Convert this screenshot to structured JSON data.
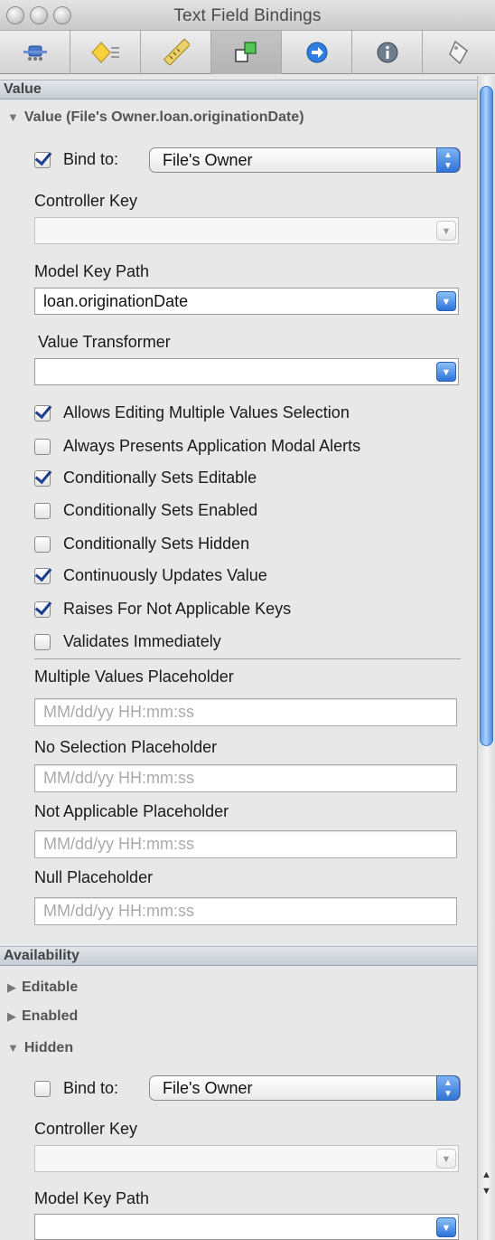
{
  "window": {
    "title": "Text Field Bindings"
  },
  "toolbar": {
    "tabs": [
      {
        "icon": "attributes-icon"
      },
      {
        "icon": "effects-icon"
      },
      {
        "icon": "size-icon"
      },
      {
        "icon": "bindings-icon",
        "active": true
      },
      {
        "icon": "connections-icon"
      },
      {
        "icon": "info-icon"
      },
      {
        "icon": "identity-icon"
      }
    ]
  },
  "value_section": {
    "header": "Value",
    "disclosure": "Value (File's Owner.loan.originationDate)",
    "bind_label": "Bind to:",
    "bind_checked": true,
    "bind_target": "File's Owner",
    "controller_key_label": "Controller Key",
    "controller_key_value": "",
    "model_key_path_label": "Model Key Path",
    "model_key_path_value": "loan.originationDate",
    "value_transformer_label": "Value Transformer",
    "value_transformer_value": "",
    "options": [
      {
        "label": "Allows Editing Multiple Values Selection",
        "checked": true
      },
      {
        "label": "Always Presents Application Modal Alerts",
        "checked": false
      },
      {
        "label": "Conditionally Sets Editable",
        "checked": true
      },
      {
        "label": "Conditionally Sets Enabled",
        "checked": false
      },
      {
        "label": "Conditionally Sets Hidden",
        "checked": false
      },
      {
        "label": "Continuously Updates Value",
        "checked": true
      },
      {
        "label": "Raises For Not Applicable Keys",
        "checked": true
      },
      {
        "label": "Validates Immediately",
        "checked": false
      }
    ],
    "placeholders": [
      {
        "label": "Multiple Values Placeholder",
        "placeholder": "MM/dd/yy HH:mm:ss"
      },
      {
        "label": "No Selection Placeholder",
        "placeholder": "MM/dd/yy HH:mm:ss"
      },
      {
        "label": "Not Applicable Placeholder",
        "placeholder": "MM/dd/yy HH:mm:ss"
      },
      {
        "label": "Null Placeholder",
        "placeholder": "MM/dd/yy HH:mm:ss"
      }
    ]
  },
  "availability_section": {
    "header": "Availability",
    "items": [
      {
        "label": "Editable",
        "expanded": false
      },
      {
        "label": "Enabled",
        "expanded": false
      },
      {
        "label": "Hidden",
        "expanded": true
      }
    ],
    "hidden": {
      "bind_label": "Bind to:",
      "bind_checked": false,
      "bind_target": "File's Owner",
      "controller_key_label": "Controller Key",
      "controller_key_value": "",
      "model_key_path_label": "Model Key Path",
      "model_key_path_value": ""
    }
  },
  "colors": {
    "accent_blue": "#2e73d8",
    "checkmark": "#1d3e8f",
    "section_header": "#c6cdd6"
  }
}
